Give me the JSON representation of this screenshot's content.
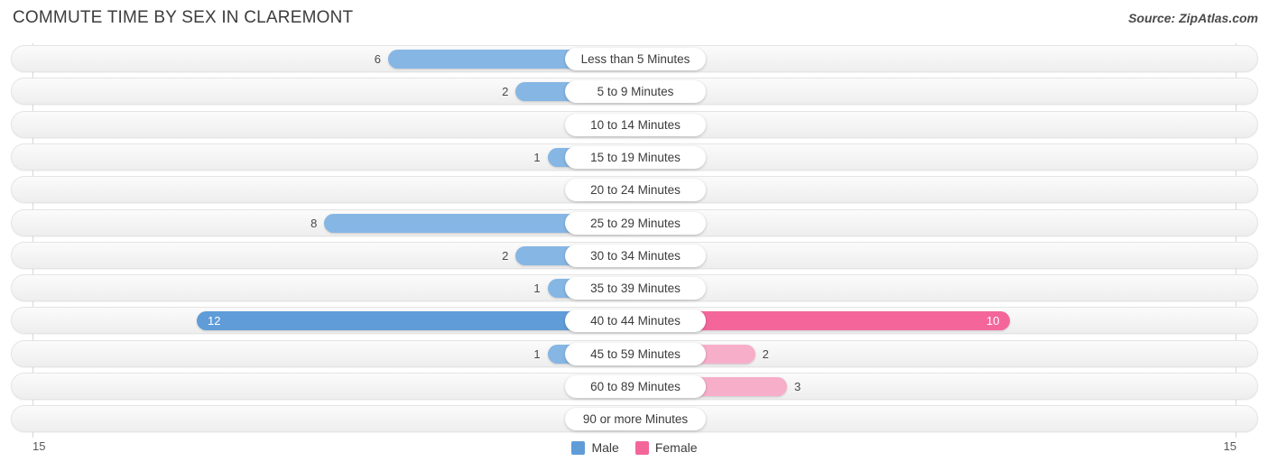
{
  "header": {
    "title": "COMMUTE TIME BY SEX IN CLAREMONT",
    "source": "Source: ZipAtlas.com"
  },
  "axis": {
    "left_tick": "15",
    "right_tick": "15"
  },
  "legend": [
    {
      "label": "Male",
      "color": "#5f9cd8"
    },
    {
      "label": "Female",
      "color": "#f4669a"
    }
  ],
  "colors": {
    "male": "#86b6e4",
    "male_highlight": "#5f9cd8",
    "female": "#f7aec9",
    "female_highlight": "#f4669a",
    "row_track": "#f4f4f4"
  },
  "chart_data": {
    "type": "bar",
    "orientation": "horizontal-diverging",
    "title": "COMMUTE TIME BY SEX IN CLAREMONT",
    "xlabel": "",
    "ylabel": "",
    "xlim": [
      15,
      15
    ],
    "grid": false,
    "legend_position": "bottom-center",
    "categories": [
      "Less than 5 Minutes",
      "5 to 9 Minutes",
      "10 to 14 Minutes",
      "15 to 19 Minutes",
      "20 to 24 Minutes",
      "25 to 29 Minutes",
      "30 to 34 Minutes",
      "35 to 39 Minutes",
      "40 to 44 Minutes",
      "45 to 59 Minutes",
      "60 to 89 Minutes",
      "90 or more Minutes"
    ],
    "series": [
      {
        "name": "Male",
        "values": [
          6,
          2,
          0,
          1,
          0,
          8,
          2,
          1,
          12,
          1,
          0,
          0
        ]
      },
      {
        "name": "Female",
        "values": [
          0,
          0,
          0,
          0,
          0,
          0,
          0,
          0,
          10,
          2,
          3,
          0
        ]
      }
    ],
    "labels": {
      "male": [
        "6",
        "2",
        "0",
        "1",
        "0",
        "8",
        "2",
        "1",
        "12",
        "1",
        "0",
        "0"
      ],
      "female": [
        "0",
        "0",
        "0",
        "0",
        "0",
        "0",
        "0",
        "0",
        "10",
        "2",
        "3",
        "0"
      ]
    }
  }
}
